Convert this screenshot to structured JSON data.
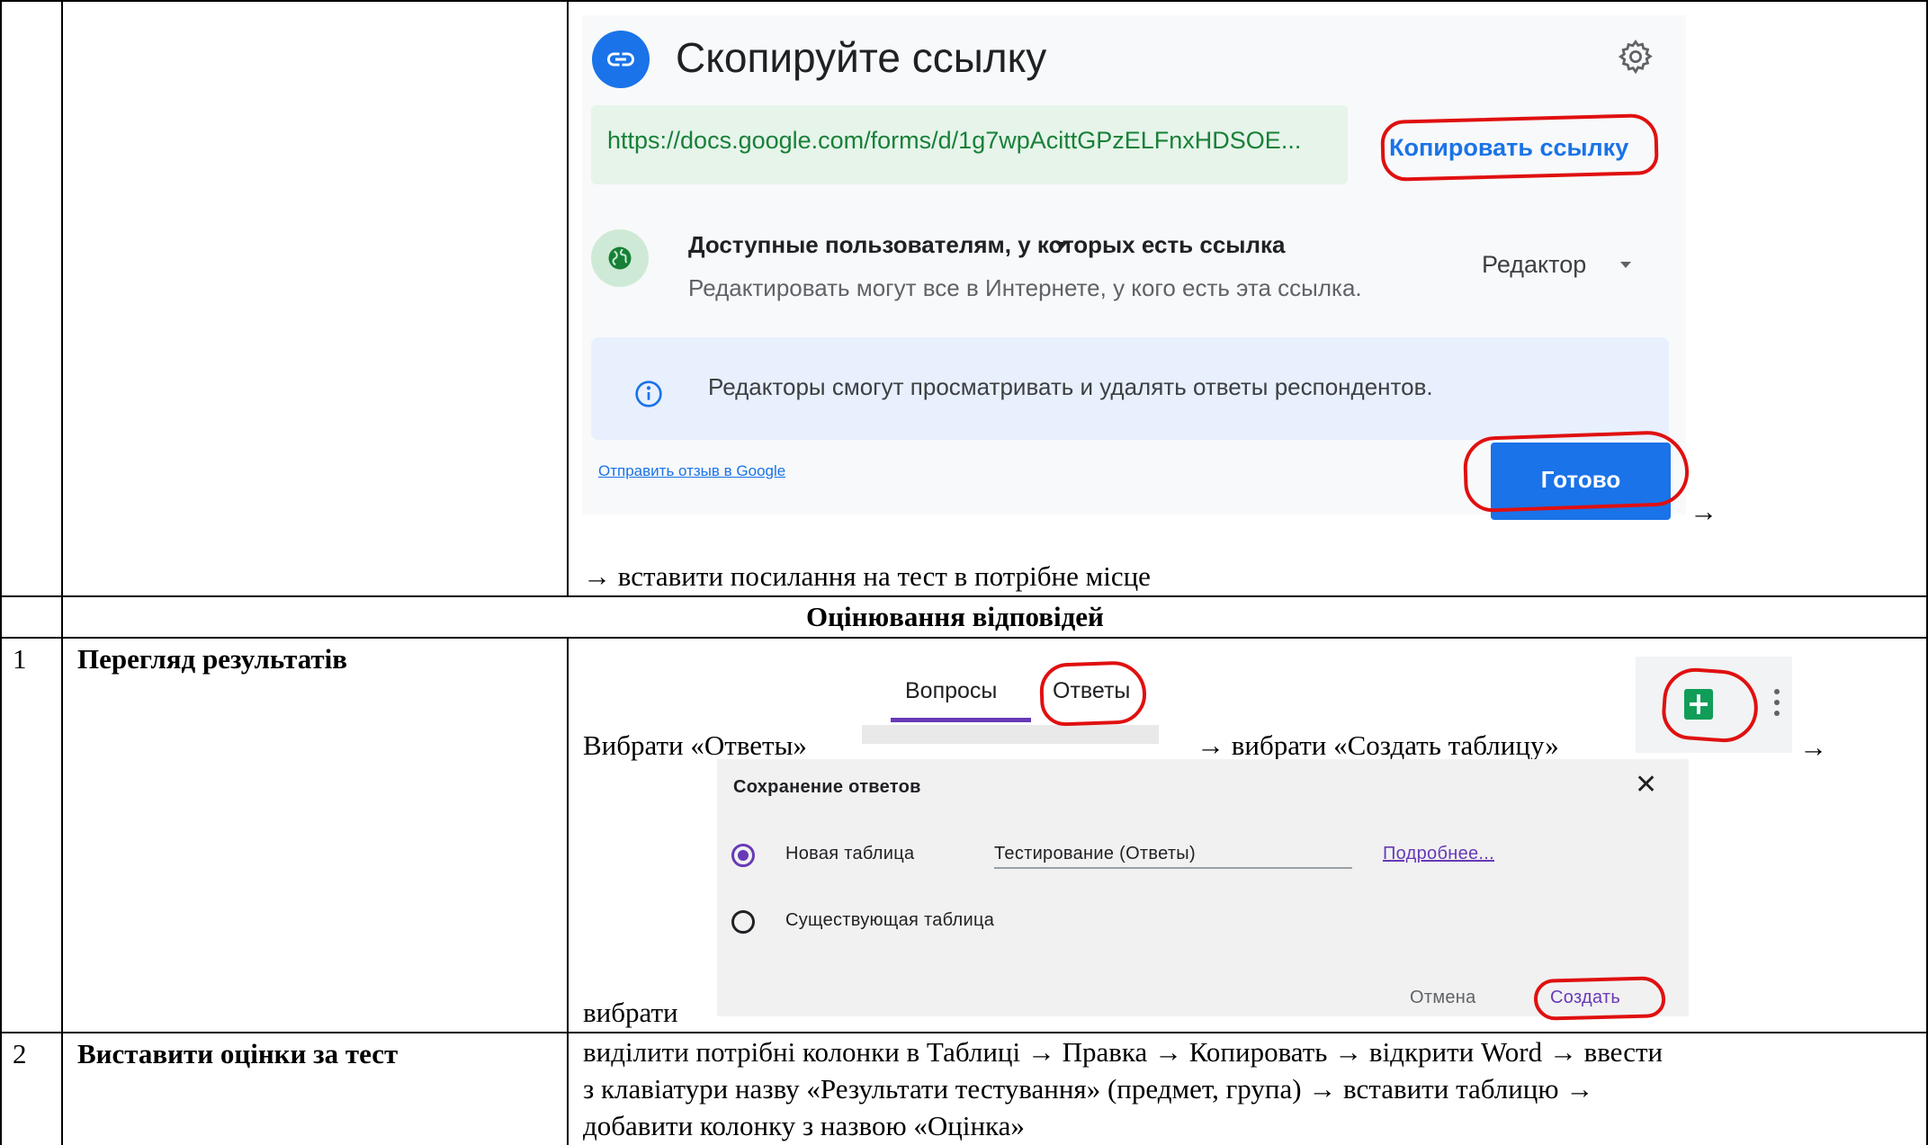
{
  "copy_link_dialog": {
    "title": "Скопируйте ссылку",
    "link_url": "https://docs.google.com/forms/d/1g7wpAcittGPzELFnxHDSOE...",
    "copy_button": "Копировать ссылку",
    "access_title": "Доступные пользователям, у которых есть ссылка",
    "access_description": "Редактировать могут все в Интернете, у кого есть эта ссылка.",
    "role": "Редактор",
    "info_text": "Редакторы смогут просматривать и удалять ответы респондентов.",
    "feedback_link": "Отправить отзыв в Google",
    "done_button": "Готово",
    "icons": [
      "link-icon",
      "gear-icon",
      "globe-icon",
      "info-icon"
    ],
    "accent_color": "#1a73e8",
    "highlight_color": "#e01010"
  },
  "row0": {
    "arrow_after_screenshot": "→",
    "instruction": "→ вставити посилання  на тест в потрібне місце"
  },
  "section_header": "Оцінювання  відповідей",
  "row1": {
    "number": "1",
    "step": "Перегляд результатів",
    "text_choose_answers": "Вибрати «Ответы»",
    "text_create_table": "→ вибрати «Создать таблицу»",
    "arrow_end": "→",
    "text_choose": "вибрати",
    "tabs": [
      "Вопросы",
      "Ответы"
    ],
    "active_tab": "Вопросы",
    "sheets_icon": "google-sheets-icon",
    "save_dialog": {
      "title": "Сохранение ответов",
      "option_new": "Новая таблица",
      "new_table_name": "Тестирование (Ответы)",
      "more_link": "Подробнее...",
      "option_existing": "Существующая таблица",
      "selected_option": "Новая таблица",
      "cancel": "Отмена",
      "create": "Создать",
      "accent_color": "#673ab7"
    }
  },
  "row2": {
    "number": "2",
    "step": "Виставити оцінки за тест",
    "lines": [
      "виділити потрібні колонки в Таблиці → Правка → Копировать → відкрити Word → ввести",
      "з клавіатури назву «Результати тестування» (предмет, група) → вставити таблицю →",
      "добавити колонку з назвою «Оцінка»"
    ]
  }
}
